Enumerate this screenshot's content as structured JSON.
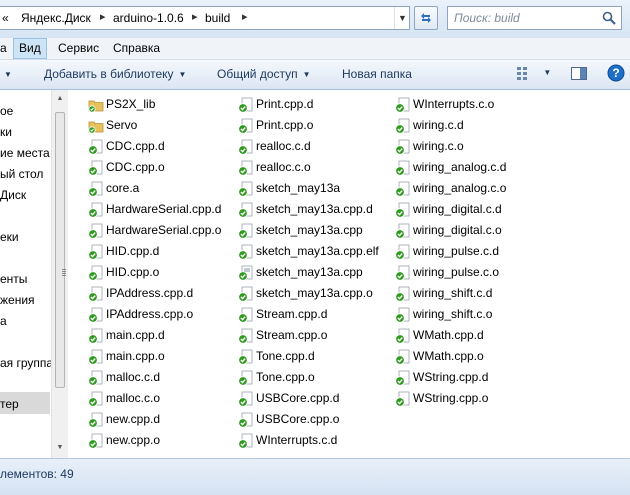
{
  "address": {
    "overflow": "«",
    "crumbs": [
      "Яндекс.Диск",
      "arduino-1.0.6",
      "build"
    ],
    "separator": "▸",
    "search_placeholder": "Поиск: build"
  },
  "menu": {
    "items": [
      {
        "label": "а"
      },
      {
        "label": "Вид"
      },
      {
        "label": "Сервис"
      },
      {
        "label": "Справка"
      }
    ]
  },
  "toolbar": {
    "add_library": "Добавить в библиотеку",
    "share": "Общий доступ",
    "new_folder": "Новая папка"
  },
  "nav": {
    "items": [
      "ое",
      "ки",
      "ие места",
      "ый стол",
      "Диск",
      "еки",
      "енты",
      "жения",
      "а",
      "ая группа",
      "тер"
    ]
  },
  "files": {
    "col1": [
      {
        "name": "PS2X_lib",
        "icon": "folder"
      },
      {
        "name": "Servo",
        "icon": "folder"
      },
      {
        "name": "CDC.cpp.d",
        "icon": "check"
      },
      {
        "name": "CDC.cpp.o",
        "icon": "check"
      },
      {
        "name": "core.a",
        "icon": "check"
      },
      {
        "name": "HardwareSerial.cpp.d",
        "icon": "check"
      },
      {
        "name": "HardwareSerial.cpp.o",
        "icon": "check"
      },
      {
        "name": "HID.cpp.d",
        "icon": "check"
      },
      {
        "name": "HID.cpp.o",
        "icon": "check"
      },
      {
        "name": "IPAddress.cpp.d",
        "icon": "check"
      },
      {
        "name": "IPAddress.cpp.o",
        "icon": "check"
      },
      {
        "name": "main.cpp.d",
        "icon": "check"
      },
      {
        "name": "main.cpp.o",
        "icon": "check"
      },
      {
        "name": "malloc.c.d",
        "icon": "check"
      },
      {
        "name": "malloc.c.o",
        "icon": "check"
      },
      {
        "name": "new.cpp.d",
        "icon": "check"
      },
      {
        "name": "new.cpp.o",
        "icon": "check"
      }
    ],
    "col2": [
      {
        "name": "Print.cpp.d",
        "icon": "check"
      },
      {
        "name": "Print.cpp.o",
        "icon": "check"
      },
      {
        "name": "realloc.c.d",
        "icon": "check"
      },
      {
        "name": "realloc.c.o",
        "icon": "check"
      },
      {
        "name": "sketch_may13a",
        "icon": "check"
      },
      {
        "name": "sketch_may13a.cpp.d",
        "icon": "check"
      },
      {
        "name": "sketch_may13a.cpp",
        "icon": "check"
      },
      {
        "name": "sketch_may13a.cpp.elf",
        "icon": "check"
      },
      {
        "name": "sketch_may13a.cpp",
        "icon": "check-doc"
      },
      {
        "name": "sketch_may13a.cpp.o",
        "icon": "check"
      },
      {
        "name": "Stream.cpp.d",
        "icon": "check"
      },
      {
        "name": "Stream.cpp.o",
        "icon": "check"
      },
      {
        "name": "Tone.cpp.d",
        "icon": "check"
      },
      {
        "name": "Tone.cpp.o",
        "icon": "check"
      },
      {
        "name": "USBCore.cpp.d",
        "icon": "check"
      },
      {
        "name": "USBCore.cpp.o",
        "icon": "check"
      },
      {
        "name": "WInterrupts.c.d",
        "icon": "check"
      }
    ],
    "col3": [
      {
        "name": "WInterrupts.c.o",
        "icon": "check"
      },
      {
        "name": "wiring.c.d",
        "icon": "check"
      },
      {
        "name": "wiring.c.o",
        "icon": "check"
      },
      {
        "name": "wiring_analog.c.d",
        "icon": "check"
      },
      {
        "name": "wiring_analog.c.o",
        "icon": "check"
      },
      {
        "name": "wiring_digital.c.d",
        "icon": "check"
      },
      {
        "name": "wiring_digital.c.o",
        "icon": "check"
      },
      {
        "name": "wiring_pulse.c.d",
        "icon": "check"
      },
      {
        "name": "wiring_pulse.c.o",
        "icon": "check"
      },
      {
        "name": "wiring_shift.c.d",
        "icon": "check"
      },
      {
        "name": "wiring_shift.c.o",
        "icon": "check"
      },
      {
        "name": "WMath.cpp.d",
        "icon": "check"
      },
      {
        "name": "WMath.cpp.o",
        "icon": "check"
      },
      {
        "name": "WString.cpp.d",
        "icon": "check"
      },
      {
        "name": "WString.cpp.o",
        "icon": "check"
      }
    ]
  },
  "status": {
    "text": "лементов: 49"
  },
  "colors": {
    "sync_green": "#2e9b1f",
    "folder_yellow": "#e8c15a",
    "menu_highlight": "#cde4f7",
    "help_blue": "#1e6fc9"
  }
}
